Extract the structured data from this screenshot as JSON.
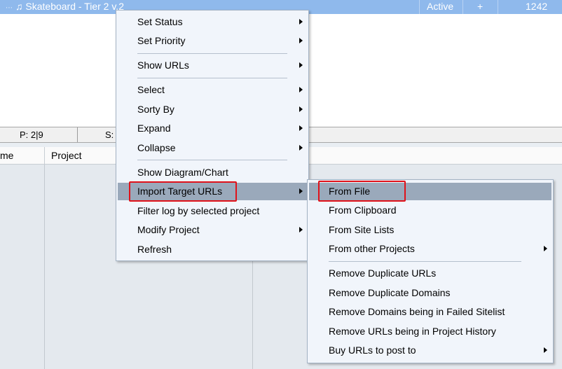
{
  "window": {
    "title": "♫ Skateboard - Tier 2 v.2",
    "status": "Active",
    "plus": "+",
    "count": "1242"
  },
  "statusbar": {
    "p_label": "P: 2|9",
    "s_label": "S:"
  },
  "grid": {
    "columns": [
      "me",
      "Project"
    ]
  },
  "context_menu": {
    "items": [
      {
        "label": "Set Status",
        "submenu": true
      },
      {
        "label": "Set Priority",
        "submenu": true
      },
      {
        "label": "Show URLs",
        "submenu": true
      },
      {
        "label": "Select",
        "submenu": true
      },
      {
        "label": "Sorty By",
        "submenu": true
      },
      {
        "label": "Expand",
        "submenu": true
      },
      {
        "label": "Collapse",
        "submenu": true
      },
      {
        "label": "Show Diagram/Chart",
        "submenu": false
      },
      {
        "label": "Import Target URLs",
        "submenu": true,
        "highlighted": true
      },
      {
        "label": "Filter log by selected project",
        "submenu": false
      },
      {
        "label": "Modify Project",
        "submenu": true
      },
      {
        "label": "Refresh",
        "submenu": false
      }
    ]
  },
  "submenu": {
    "items": [
      {
        "label": "From File",
        "submenu": false,
        "highlighted": true
      },
      {
        "label": "From Clipboard",
        "submenu": false
      },
      {
        "label": "From Site Lists",
        "submenu": false
      },
      {
        "label": "From other Projects",
        "submenu": true
      },
      {
        "label": "Remove Duplicate URLs",
        "submenu": false
      },
      {
        "label": "Remove Duplicate Domains",
        "submenu": false
      },
      {
        "label": "Remove Domains being in Failed Sitelist",
        "submenu": false
      },
      {
        "label": "Remove URLs being in Project History",
        "submenu": false
      },
      {
        "label": "Buy URLs to post to",
        "submenu": true
      }
    ]
  },
  "colors": {
    "selection": "#8fb9ec",
    "menu_bg": "#f1f5fb",
    "menu_highlight": "#9aa9bb",
    "annotation_red": "#e0121a"
  }
}
